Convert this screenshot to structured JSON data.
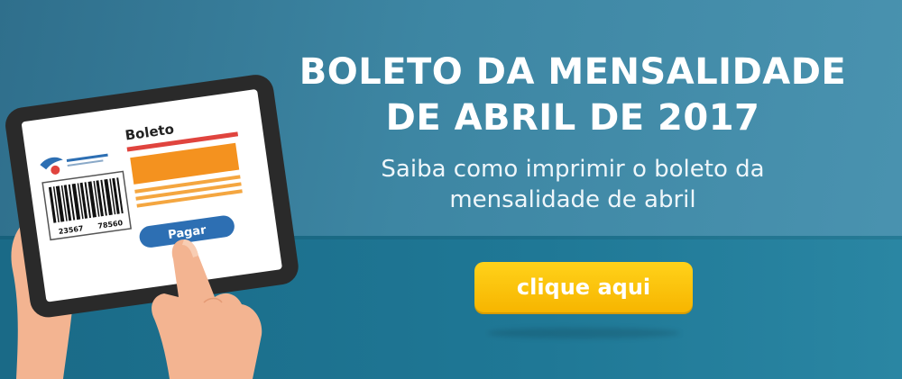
{
  "headline": {
    "line1": "BOLETO DA MENSALIDADE",
    "line2": "DE ABRIL DE 2017"
  },
  "subtitle": {
    "line1": "Saiba como imprimir o boleto da",
    "line2": "mensalidade de abril"
  },
  "cta": {
    "label": "clique aqui"
  },
  "tablet": {
    "screen_title": "Boleto",
    "barcode_left": "23567",
    "barcode_right": "78560",
    "pay_button": "Pagar"
  },
  "colors": {
    "background": "#3d86a3",
    "band": "#1f7896",
    "cta": "#f9bc00",
    "red_bar": "#e0443e",
    "orange_block": "#f4921f",
    "pay_button": "#2d6fb3",
    "tablet_frame": "#2a2a2a"
  }
}
